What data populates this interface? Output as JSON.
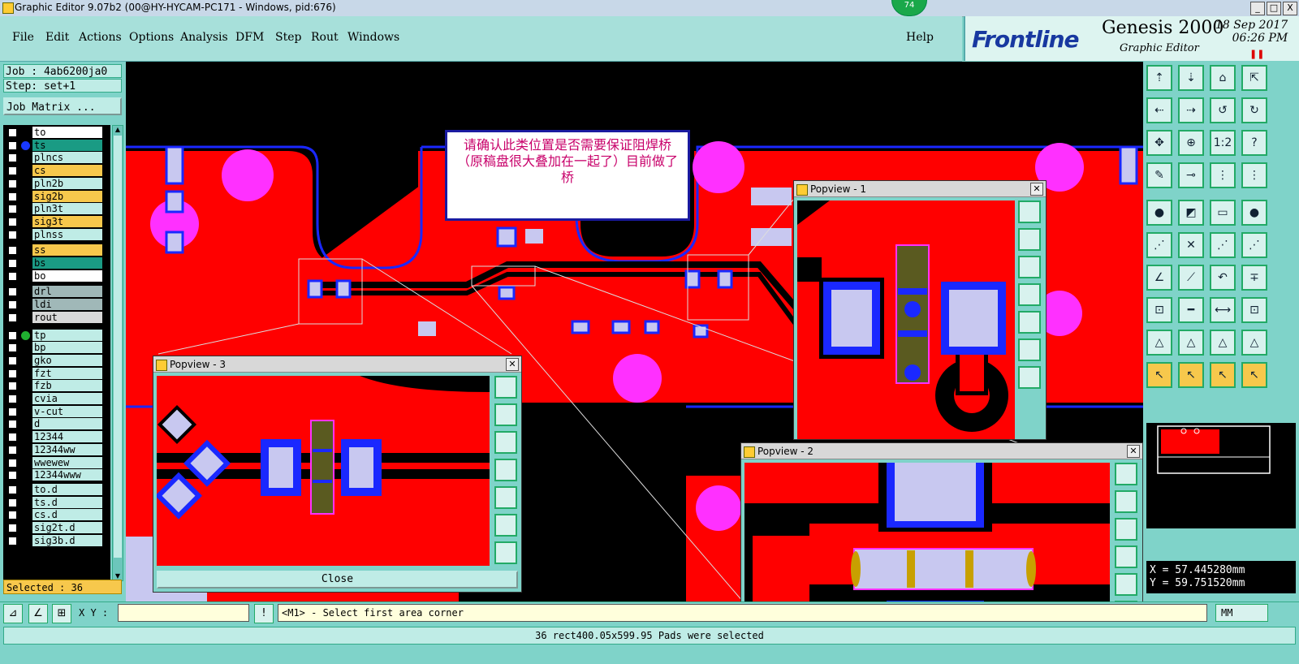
{
  "window": {
    "title": "Graphic Editor 9.07b2 (00@HY-HYCAM-PC171 - Windows, pid:676)",
    "badge": "74",
    "controls": [
      "_",
      "□",
      "X"
    ]
  },
  "menu": {
    "items": [
      "File",
      "Edit",
      "Actions",
      "Options",
      "Analysis",
      "DFM",
      "Step",
      "Rout",
      "Windows"
    ],
    "help": "Help"
  },
  "brand": {
    "logo": "Frontline",
    "product": "Genesis 2000",
    "subtitle": "Graphic Editor",
    "date": "18 Sep 2017",
    "time": "06:26 PM"
  },
  "job": {
    "job_label": "Job : 4ab6200ja0",
    "step_label": "Step: set+1",
    "matrix_button": "Job Matrix ..."
  },
  "layers": [
    {
      "name": "to",
      "color": "#ffffff",
      "dot": ""
    },
    {
      "name": "ts",
      "color": "#1a9b84",
      "dot": "#1838ff"
    },
    {
      "name": "plncs",
      "color": "#bfece6",
      "dot": ""
    },
    {
      "name": "cs",
      "color": "#f7c84c",
      "dot": ""
    },
    {
      "name": "pln2b",
      "color": "#bfece6",
      "dot": ""
    },
    {
      "name": "sig2b",
      "color": "#f7c84c",
      "dot": ""
    },
    {
      "name": "pln3t",
      "color": "#bfece6",
      "dot": ""
    },
    {
      "name": "sig3t",
      "color": "#f7c84c",
      "dot": ""
    },
    {
      "name": "plnss",
      "color": "#bfece6",
      "dot": ""
    },
    {
      "name": "ss",
      "color": "#f7c84c",
      "dot": ""
    },
    {
      "name": "bs",
      "color": "#1a9b84",
      "dot": ""
    },
    {
      "name": "bo",
      "color": "#ffffff",
      "dot": ""
    },
    {
      "name": "drl",
      "color": "#a0b8b8",
      "dot": ""
    },
    {
      "name": "ldi",
      "color": "#a0b8b8",
      "dot": ""
    },
    {
      "name": "rout",
      "color": "#d8d8d8",
      "dot": ""
    },
    {
      "name": "tp",
      "color": "#bfece6",
      "dot": "#20b030"
    },
    {
      "name": "bp",
      "color": "#bfece6",
      "dot": ""
    },
    {
      "name": "gko",
      "color": "#bfece6",
      "dot": ""
    },
    {
      "name": "fzt",
      "color": "#bfece6",
      "dot": ""
    },
    {
      "name": "fzb",
      "color": "#bfece6",
      "dot": ""
    },
    {
      "name": "cvia",
      "color": "#bfece6",
      "dot": ""
    },
    {
      "name": "v-cut",
      "color": "#bfece6",
      "dot": ""
    },
    {
      "name": "d",
      "color": "#bfece6",
      "dot": ""
    },
    {
      "name": "12344",
      "color": "#bfece6",
      "dot": ""
    },
    {
      "name": "12344ww",
      "color": "#bfece6",
      "dot": ""
    },
    {
      "name": "wwewew",
      "color": "#bfece6",
      "dot": ""
    },
    {
      "name": "12344www",
      "color": "#bfece6",
      "dot": ""
    },
    {
      "name": "to.d",
      "color": "#bfece6",
      "dot": ""
    },
    {
      "name": "ts.d",
      "color": "#bfece6",
      "dot": ""
    },
    {
      "name": "cs.d",
      "color": "#bfece6",
      "dot": ""
    },
    {
      "name": "sig2t.d",
      "color": "#bfece6",
      "dot": ""
    },
    {
      "name": "sig3b.d",
      "color": "#bfece6",
      "dot": ""
    }
  ],
  "selected": "Selected : 36",
  "note": "请确认此类位置是否需要保证阻焊桥（原稿盘很大叠加在一起了）目前做了桥",
  "popviews": {
    "p1": "Popview - 1",
    "p2": "Popview - 2",
    "p3": "Popview - 3",
    "close_button": "Close"
  },
  "cmd": {
    "xy_label": "X Y :",
    "xy_value": "",
    "prompt": "<M1> - Select first area corner",
    "units": "MM"
  },
  "coords": {
    "x": "X = 57.445280mm",
    "y": "Y = 59.751520mm"
  },
  "status": "36 rect400.05x599.95 Pads were selected",
  "colors": {
    "copper": "#ff0000",
    "pad": "#c8c8f0",
    "mask": "#1a28ff",
    "drill": "#ff30ff",
    "panel": "#7fd3c9"
  },
  "icons": [
    "select-icon",
    "zoom-icon",
    "grid-icon",
    "warning-icon",
    "pan-icon",
    "route-icon"
  ]
}
